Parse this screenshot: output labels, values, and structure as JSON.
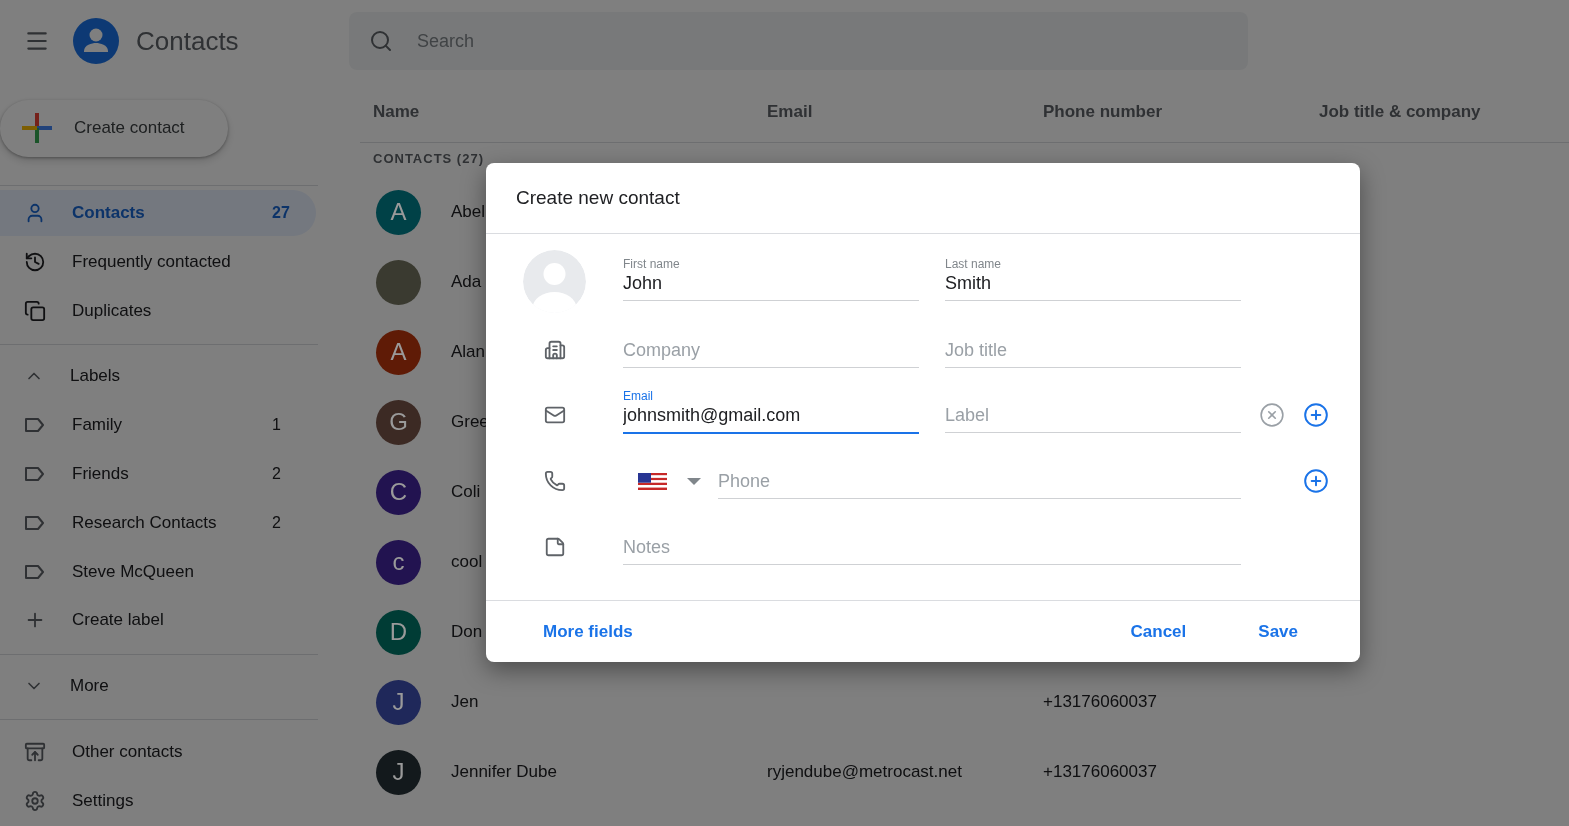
{
  "app": {
    "title": "Contacts"
  },
  "search": {
    "placeholder": "Search"
  },
  "create_button": "Create contact",
  "nav": [
    {
      "label": "Contacts",
      "count": "27",
      "selected": true
    },
    {
      "label": "Frequently contacted",
      "selected": false
    },
    {
      "label": "Duplicates",
      "selected": false
    }
  ],
  "labels_section": {
    "title": "Labels",
    "expanded": true,
    "items": [
      {
        "label": "Family",
        "count": "1"
      },
      {
        "label": "Friends",
        "count": "2"
      },
      {
        "label": "Research Contacts",
        "count": "2"
      },
      {
        "label": "Steve McQueen"
      }
    ],
    "create": "Create label"
  },
  "more": {
    "label": "More",
    "expanded": false
  },
  "bottom_nav": [
    {
      "label": "Other contacts"
    },
    {
      "label": "Settings"
    }
  ],
  "table": {
    "columns": [
      "Name",
      "Email",
      "Phone number",
      "Job title & company"
    ],
    "section": "CONTACTS (27)",
    "rows": [
      {
        "initial": "A",
        "color": "#004147",
        "name": "Abel"
      },
      {
        "photo": true,
        "name": "Ada"
      },
      {
        "initial": "A",
        "color": "#5f1b06",
        "name": "Alan"
      },
      {
        "initial": "G",
        "color": "#3c2a24",
        "name": "Gree"
      },
      {
        "initial": "C",
        "color": "#221350",
        "name": "Coli"
      },
      {
        "initial": "c",
        "color": "#221350",
        "name": "cool"
      },
      {
        "initial": "D",
        "color": "#003c35",
        "name": "Don"
      },
      {
        "initial": "J",
        "color": "#1f285a",
        "name": "Jen",
        "phone": "+13176060037"
      },
      {
        "initial": "J",
        "color": "#13191c",
        "name": "Jennifer Dube",
        "email": "ryjendube@metrocast.net",
        "phone": "+13176060037"
      }
    ]
  },
  "dialog": {
    "title": "Create new contact",
    "first_name": {
      "label": "First name",
      "value": "John"
    },
    "last_name": {
      "label": "Last name",
      "value": "Smith"
    },
    "company": {
      "placeholder": "Company"
    },
    "job_title": {
      "placeholder": "Job title"
    },
    "email": {
      "label": "Email",
      "value": "johnsmith@gmail.com",
      "focused": true
    },
    "email_label": {
      "placeholder": "Label"
    },
    "phone": {
      "placeholder": "Phone"
    },
    "notes": {
      "placeholder": "Notes"
    },
    "actions": {
      "more": "More fields",
      "cancel": "Cancel",
      "save": "Save"
    }
  }
}
